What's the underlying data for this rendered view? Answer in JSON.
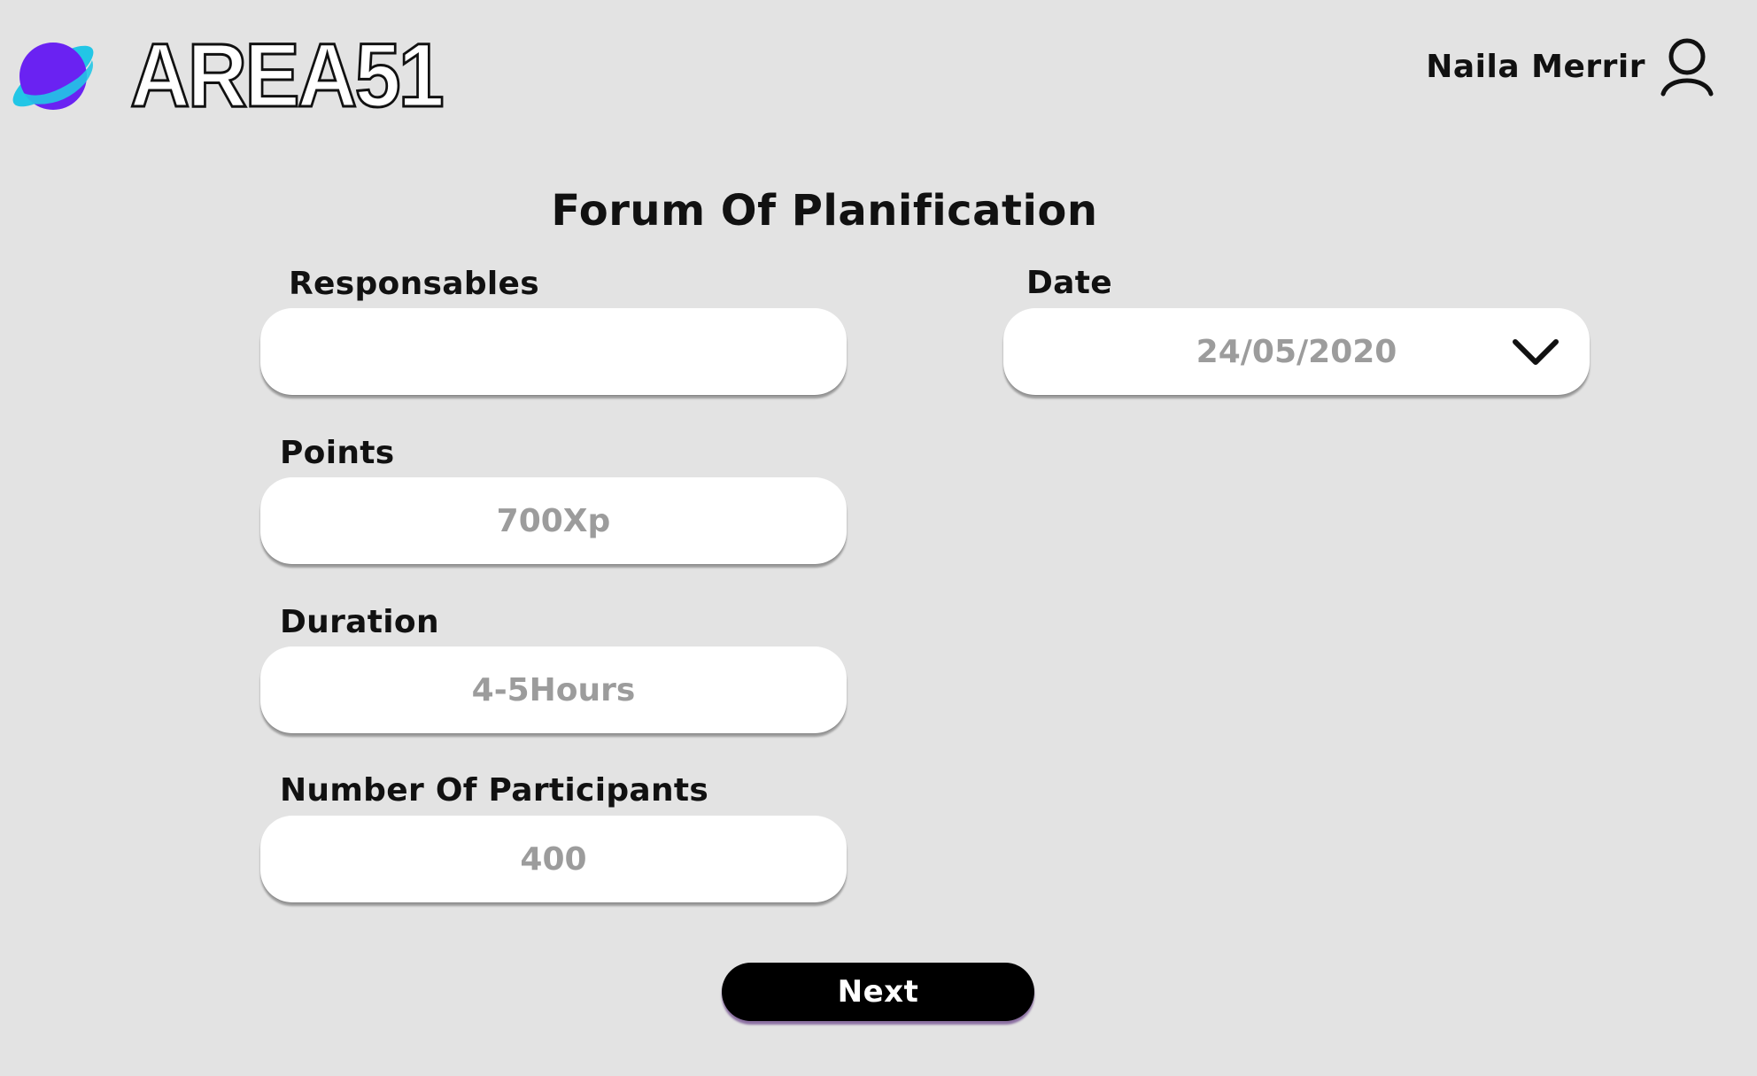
{
  "brand": {
    "name": "AREA51",
    "accent_primary": "#6a22f2",
    "accent_secondary": "#22c6e6"
  },
  "user": {
    "name": "Naila Merrir",
    "icon": "user-icon"
  },
  "form": {
    "title": "Forum Of Planification",
    "responsables": {
      "label": "Responsables",
      "value": ""
    },
    "date": {
      "label": "Date",
      "value": "24/05/2020",
      "icon": "chevron-down-icon"
    },
    "points": {
      "label": "Points",
      "placeholder": "700Xp"
    },
    "duration": {
      "label": "Duration",
      "placeholder": "4-5Hours"
    },
    "participants": {
      "label": "Number Of Participants",
      "placeholder": "400"
    }
  },
  "actions": {
    "next_label": "Next",
    "next_color": "#000000"
  }
}
